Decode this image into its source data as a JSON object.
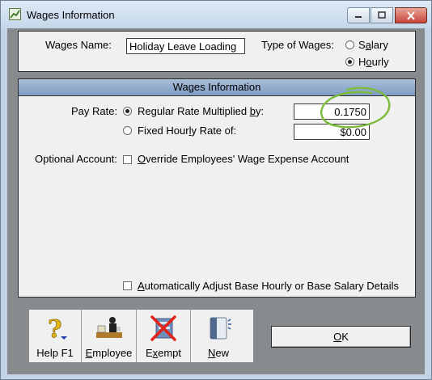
{
  "window": {
    "title": "Wages Information"
  },
  "header": {
    "wages_name_label": "Wages Name:",
    "wages_name_value": "Holiday Leave Loading",
    "type_label": "Type of Wages:",
    "type_options": [
      {
        "label": "Salary",
        "selected": false
      },
      {
        "label": "Hourly",
        "selected": true
      }
    ]
  },
  "details": {
    "section_title": "Wages Information",
    "pay_rate_label": "Pay Rate:",
    "regular_rate_label": "Regular Rate Multiplied by:",
    "regular_rate_value": "0.1750",
    "fixed_rate_label": "Fixed Hourly Rate of:",
    "fixed_rate_value": "$0.00",
    "optional_account_label": "Optional Account:",
    "override_label": "Override Employees' Wage Expense Account",
    "auto_adjust_label": "Automatically Adjust Base Hourly or Base Salary Details"
  },
  "toolbar": {
    "help_label": "Help F1",
    "employee_label": "Employee",
    "exempt_label": "Exempt",
    "new_label": "New"
  },
  "ok_label": "OK",
  "colors": {
    "highlight_circle": "#7cbb3a"
  }
}
